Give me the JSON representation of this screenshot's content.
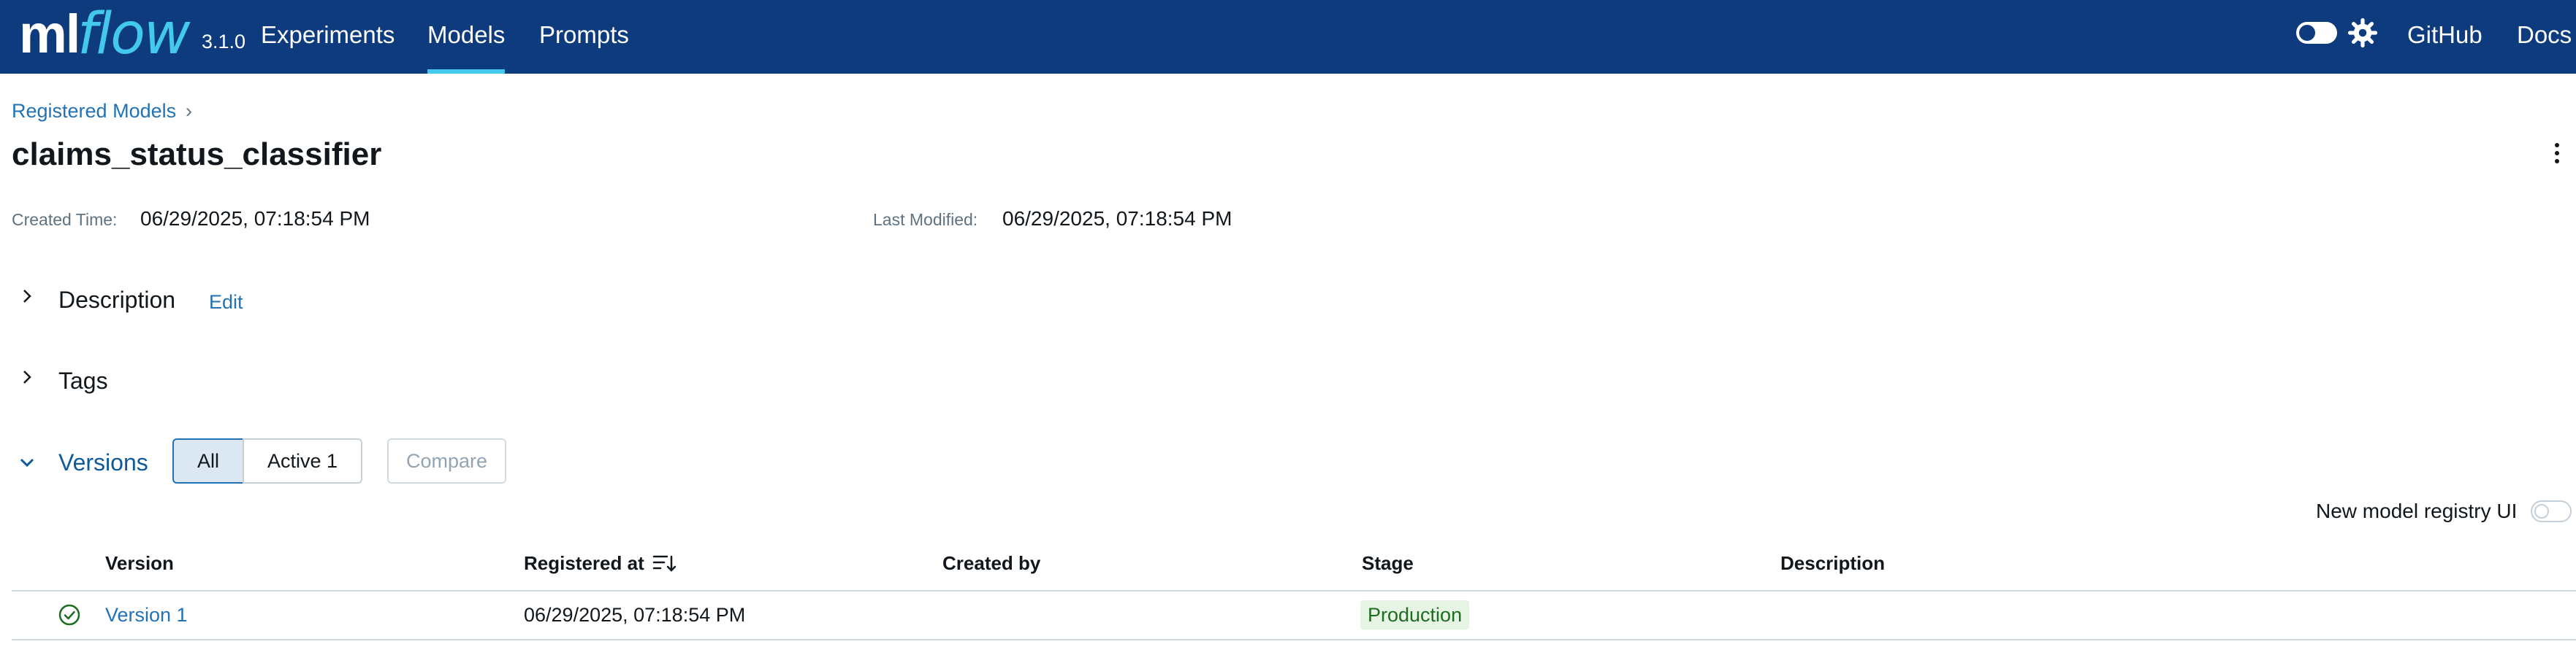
{
  "app": {
    "logo_ml": "ml",
    "logo_flow": "flow",
    "version": "3.1.0",
    "colors": {
      "header_bg": "#0e3b7d",
      "accent": "#43c9ed",
      "link": "#2272b4",
      "success": "#1e6d22"
    }
  },
  "nav": {
    "items": [
      {
        "label": "Experiments",
        "active": false
      },
      {
        "label": "Models",
        "active": true
      },
      {
        "label": "Prompts",
        "active": false
      }
    ],
    "right": {
      "github": "GitHub",
      "docs": "Docs",
      "theme_icon": "gear-icon"
    }
  },
  "breadcrumb": {
    "label": "Registered Models",
    "separator": "›"
  },
  "model": {
    "name": "claims_status_classifier",
    "created_label": "Created Time:",
    "created_value": "06/29/2025, 07:18:54 PM",
    "modified_label": "Last Modified:",
    "modified_value": "06/29/2025, 07:18:54 PM"
  },
  "sections": {
    "description": {
      "title": "Description",
      "edit": "Edit"
    },
    "tags": {
      "title": "Tags"
    },
    "versions": {
      "title": "Versions"
    }
  },
  "filters": {
    "all": "All",
    "active": "Active 1",
    "compare": "Compare"
  },
  "toggle": {
    "label": "New model registry UI",
    "on": false
  },
  "table": {
    "headers": {
      "version": "Version",
      "registered_at": "Registered at",
      "created_by": "Created by",
      "stage": "Stage",
      "description": "Description"
    },
    "rows": [
      {
        "version": "Version 1",
        "registered_at": "06/29/2025, 07:18:54 PM",
        "created_by": "",
        "stage": "Production",
        "description": "",
        "status_icon": "check-circle-icon"
      }
    ]
  }
}
